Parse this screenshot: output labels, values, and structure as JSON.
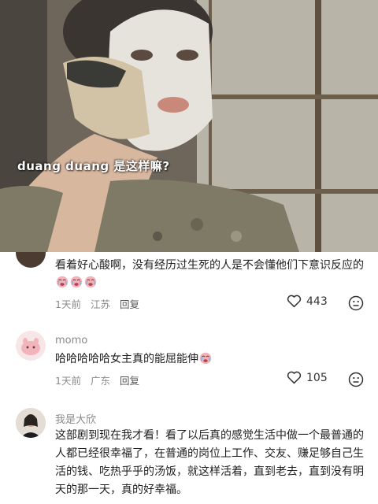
{
  "video": {
    "subtitle": "duang duang 是这样嘛?"
  },
  "comments": [
    {
      "username": "",
      "text": "看着好心酸啊，没有经历过生死的人是不会懂他们下意识反应的",
      "emoji_count": 3,
      "time": "1天前",
      "location": "江苏",
      "reply_label": "回复",
      "likes": "443"
    },
    {
      "username": "momo",
      "text": "哈哈哈哈哈女主真的能屈能伸",
      "emoji_count": 1,
      "time": "1天前",
      "location": "广东",
      "reply_label": "回复",
      "likes": "105"
    },
    {
      "username": "我是大欣",
      "text": "这部剧到现在我才看！看了以后真的感觉生活中做一个最普通的人都已经很幸福了，在普通的岗位上工作、交友、赚足够自己生活的钱、吃热乎乎的汤饭，就这样活着，直到老去，直到没有明天的那一天，真的好幸福。"
    }
  ],
  "colors": {
    "meta": "#8a8a8a",
    "text": "#1f1f1f",
    "emoji_face": "#f2b3ba"
  },
  "icons": [
    "heart-outline-icon",
    "emoji-face-icon",
    "crying-emoji-icon"
  ]
}
